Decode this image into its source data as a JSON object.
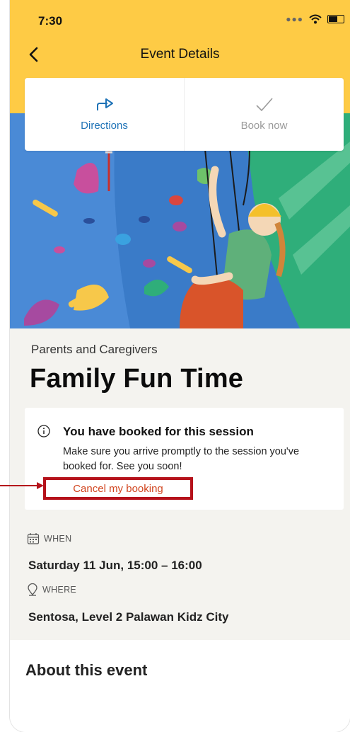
{
  "status_bar": {
    "time": "7:30"
  },
  "header": {
    "title": "Event Details"
  },
  "actions": {
    "directions_label": "Directions",
    "book_label": "Book now"
  },
  "event": {
    "category": "Parents and Caregivers",
    "title": "Family Fun Time"
  },
  "notice": {
    "title": "You have booked for this session",
    "body": "Make sure you arrive promptly to the session you've booked for. See you soon!",
    "cancel_label": "Cancel my booking"
  },
  "when": {
    "label": "WHEN",
    "value": "Saturday 11 Jun, 15:00 – 16:00"
  },
  "where": {
    "label": "WHERE",
    "value": "Sentosa, Level 2 Palawan Kidz City"
  },
  "about": {
    "title": "About this event"
  },
  "colors": {
    "header_yellow": "#fecb45",
    "link_blue": "#1f73b7",
    "cancel_orange": "#d1451f",
    "highlight_red": "#b5121b",
    "wall_blue": "#3a7bc8",
    "wall_green": "#2fae7a"
  }
}
